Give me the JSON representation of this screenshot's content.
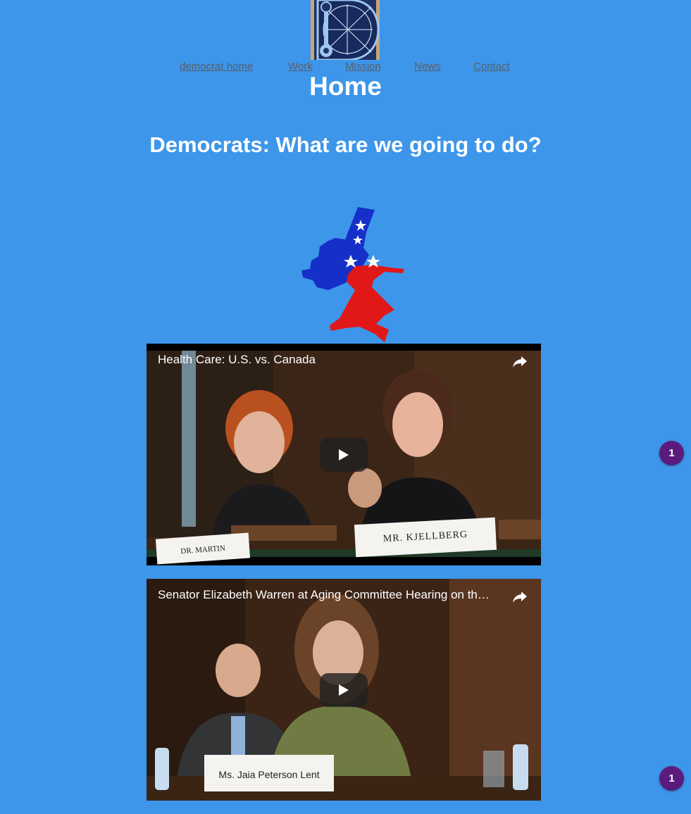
{
  "logo": {
    "icon": "d-monogram-logo"
  },
  "nav": {
    "items": [
      {
        "label": "democrat home"
      },
      {
        "label": "Work"
      },
      {
        "label": "Mission"
      },
      {
        "label": "News"
      },
      {
        "label": "Contact"
      }
    ]
  },
  "page": {
    "title": "Home",
    "subtitle": "Democrats: What are we going to do?"
  },
  "emblem": {
    "icon": "democratic-donkey-logo"
  },
  "videos": [
    {
      "title": "Health Care: U.S. vs. Canada",
      "nameplates": [
        "DR. MARTIN",
        "MR. KJELLBERG"
      ]
    },
    {
      "title": "Senator Elizabeth Warren at Aging Committee Hearing on the Rising Cost of Prescription Drugs",
      "nameplates": [
        "Ms. Jaia Peterson Lent"
      ]
    }
  ],
  "badges": [
    {
      "count": "1"
    },
    {
      "count": "1"
    }
  ],
  "colors": {
    "background": "#3d96ea",
    "nav_link": "#555f6b",
    "badge": "#5b1b7d",
    "donkey_blue": "#1530c8",
    "donkey_red": "#e01818"
  }
}
